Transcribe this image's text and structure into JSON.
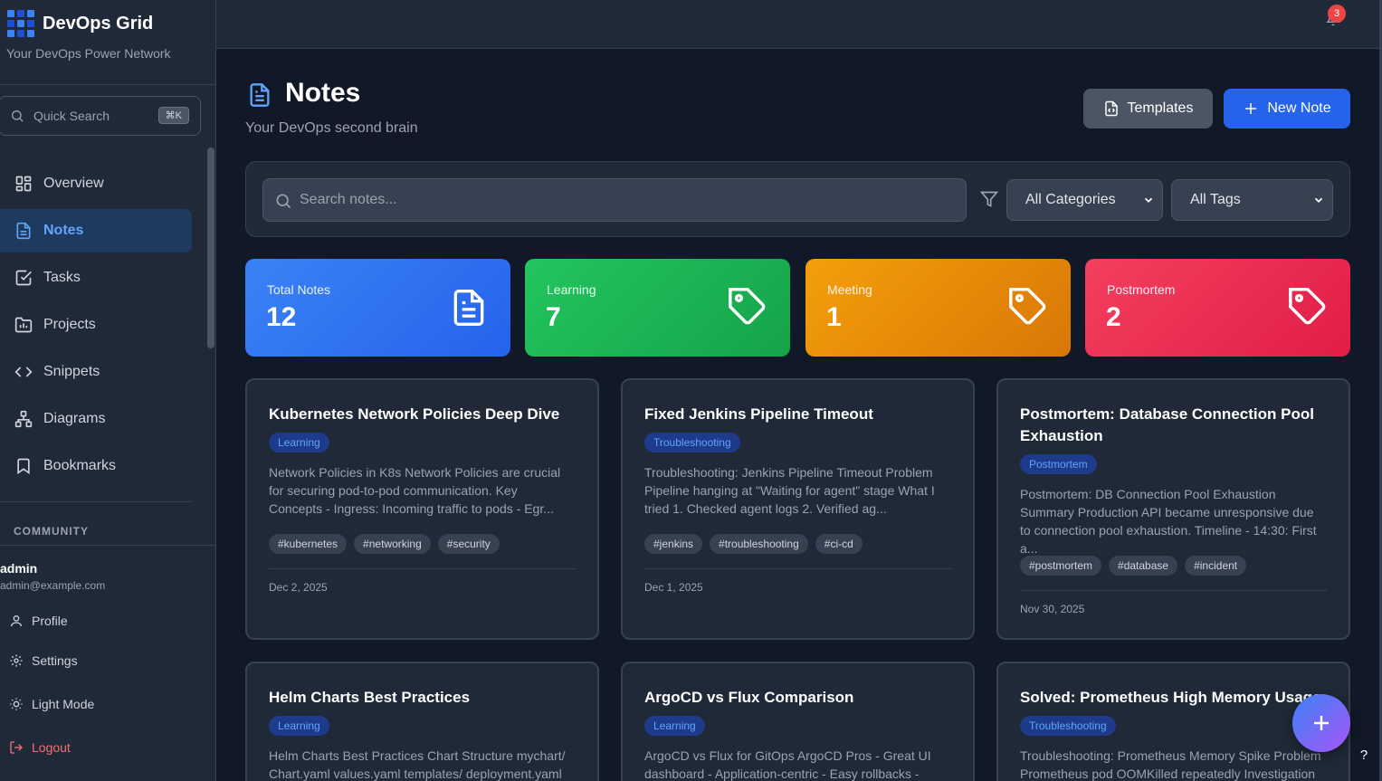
{
  "brand": {
    "title": "DevOps Grid",
    "subtitle": "Your DevOps Power Network"
  },
  "quick_search": {
    "label": "Quick Search",
    "shortcut": "⌘K"
  },
  "nav": [
    {
      "label": "Overview",
      "icon": "grid-icon"
    },
    {
      "label": "Notes",
      "icon": "file-text-icon",
      "active": true
    },
    {
      "label": "Tasks",
      "icon": "checkbox-icon"
    },
    {
      "label": "Projects",
      "icon": "folder-icon"
    },
    {
      "label": "Snippets",
      "icon": "code-icon"
    },
    {
      "label": "Diagrams",
      "icon": "network-icon"
    },
    {
      "label": "Bookmarks",
      "icon": "bookmark-icon"
    }
  ],
  "community_label": "COMMUNITY",
  "user": {
    "name": "admin",
    "email": "admin@example.com"
  },
  "footer_menu": {
    "profile": "Profile",
    "settings": "Settings",
    "theme": "Light Mode",
    "logout": "Logout"
  },
  "notifications": {
    "count": "3"
  },
  "header": {
    "title": "Notes",
    "subtitle": "Your DevOps second brain",
    "templates_label": "Templates",
    "new_note_label": "New Note"
  },
  "filters": {
    "search_placeholder": "Search notes...",
    "category": "All Categories",
    "tag": "All Tags"
  },
  "stats": [
    {
      "label": "Total Notes",
      "value": "12",
      "icon": "file-text-icon",
      "color": "#3b82f6"
    },
    {
      "label": "Learning",
      "value": "7",
      "icon": "tag-icon",
      "color": "#22c55e"
    },
    {
      "label": "Meeting",
      "value": "1",
      "icon": "tag-icon",
      "color": "#f59e0b"
    },
    {
      "label": "Postmortem",
      "value": "2",
      "icon": "tag-icon",
      "color": "#f43f5e"
    }
  ],
  "notes": [
    {
      "title": "Kubernetes Network Policies Deep Dive",
      "category": "Learning",
      "excerpt": "Network Policies in K8s Network Policies are crucial for securing pod-to-pod communication. Key Concepts - Ingress: Incoming traffic to pods - Egr...",
      "tags": [
        "#kubernetes",
        "#networking",
        "#security"
      ],
      "date": "Dec 2, 2025"
    },
    {
      "title": "Fixed Jenkins Pipeline Timeout",
      "category": "Troubleshooting",
      "excerpt": "Troubleshooting: Jenkins Pipeline Timeout Problem Pipeline hanging at \"Waiting for agent\" stage What I tried 1. Checked agent logs 2. Verified ag...",
      "tags": [
        "#jenkins",
        "#troubleshooting",
        "#ci-cd"
      ],
      "date": "Dec 1, 2025"
    },
    {
      "title": "Postmortem: Database Connection Pool Exhaustion",
      "category": "Postmortem",
      "excerpt": "Postmortem: DB Connection Pool Exhaustion Summary Production API became unresponsive due to connection pool exhaustion. Timeline - 14:30: First a...",
      "tags": [
        "#postmortem",
        "#database",
        "#incident"
      ],
      "date": "Nov 30, 2025"
    },
    {
      "title": "Helm Charts Best Practices",
      "category": "Learning",
      "excerpt": "Helm Charts Best Practices Chart Structure mychart/ Chart.yaml values.yaml templates/ deployment.yaml"
    },
    {
      "title": "ArgoCD vs Flux Comparison",
      "category": "Learning",
      "excerpt": "ArgoCD vs Flux for GitOps ArgoCD Pros - Great UI dashboard - Application-centric - Easy rollbacks -"
    },
    {
      "title": "Solved: Prometheus High Memory Usage",
      "category": "Troubleshooting",
      "excerpt": "Troubleshooting: Prometheus Memory Spike Problem Prometheus pod OOMKilled repeatedly Investigation"
    }
  ],
  "help_label": "?"
}
